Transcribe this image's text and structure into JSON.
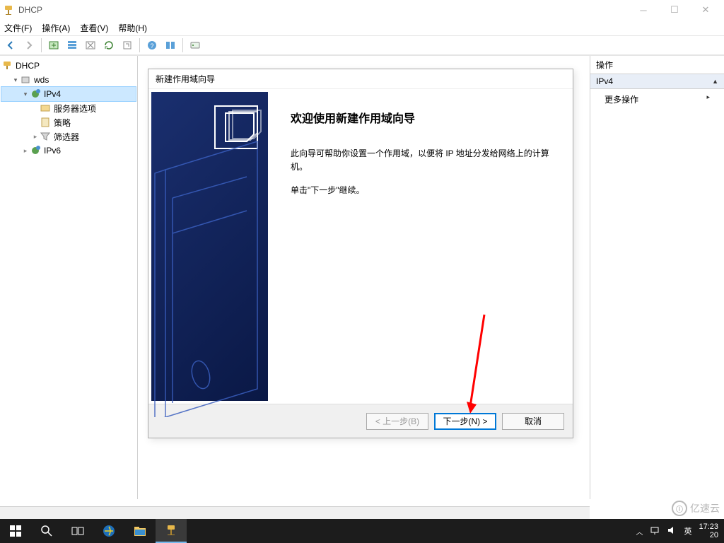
{
  "window": {
    "title": "DHCP"
  },
  "menu": {
    "file": "文件(F)",
    "action": "操作(A)",
    "view": "查看(V)",
    "help": "帮助(H)"
  },
  "tree": {
    "root": "DHCP",
    "server": "wds",
    "ipv4": "IPv4",
    "server_options": "服务器选项",
    "policies": "策略",
    "filters": "筛选器",
    "ipv6": "IPv6"
  },
  "actions_pane": {
    "header": "操作",
    "section": "IPv4",
    "more": "更多操作"
  },
  "dialog": {
    "title": "新建作用域向导",
    "heading": "欢迎使用新建作用域向导",
    "body1": "此向导可帮助你设置一个作用域，以便将 IP 地址分发给网络上的计算机。",
    "body2": "单击\"下一步\"继续。",
    "back": "< 上一步(B)",
    "next": "下一步(N) >",
    "cancel": "取消"
  },
  "taskbar": {
    "ime": "英",
    "time": "17:23",
    "date_prefix": "20"
  },
  "watermark": {
    "text": "亿速云"
  }
}
